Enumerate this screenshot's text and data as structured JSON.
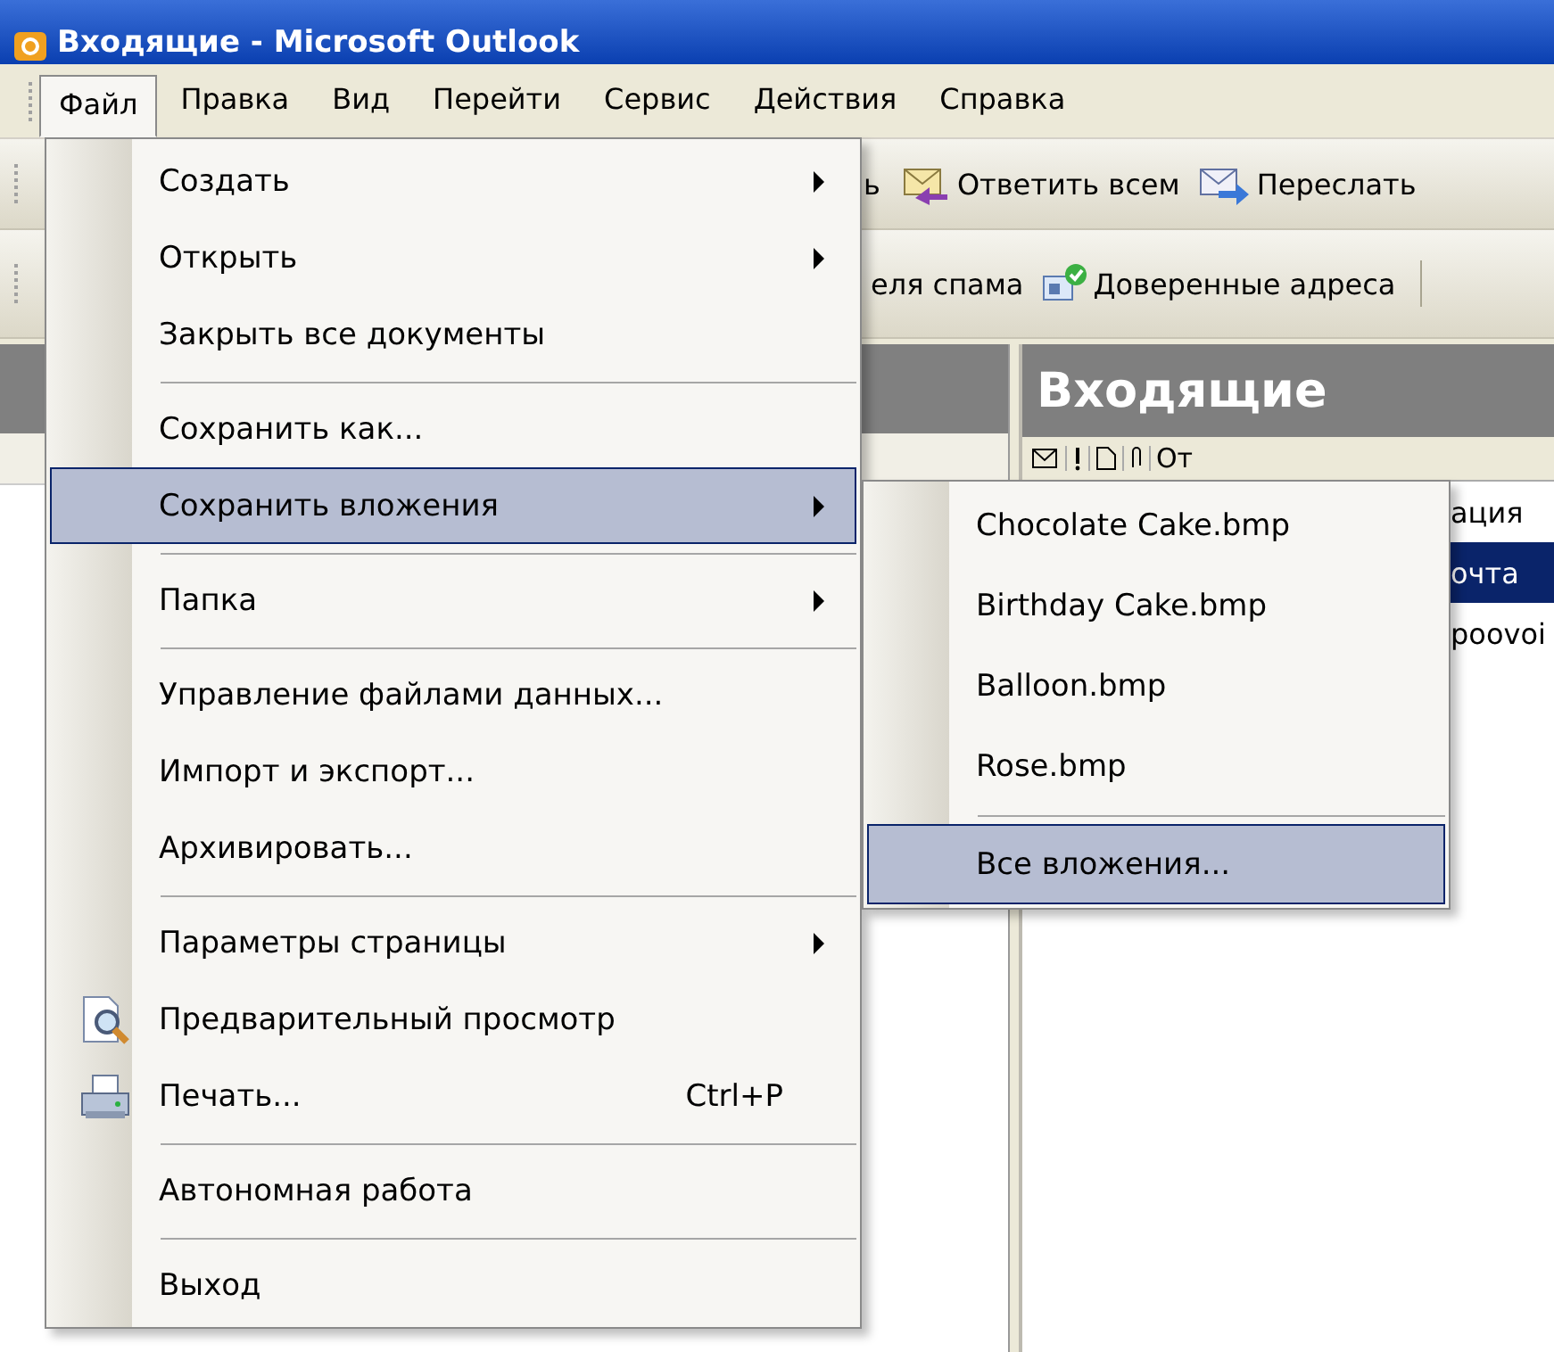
{
  "window": {
    "title": "Входящие - Microsoft Outlook"
  },
  "menu_bar": [
    {
      "label": "Файл",
      "selected": true
    },
    {
      "label": "Правка",
      "selected": false
    },
    {
      "label": "Вид",
      "selected": false
    },
    {
      "label": "Перейти",
      "selected": false
    },
    {
      "label": "Сервис",
      "selected": false
    },
    {
      "label": "Действия",
      "selected": false
    },
    {
      "label": "Справка",
      "selected": false
    }
  ],
  "toolbar_1": [
    {
      "label": "ь",
      "kind": "text"
    },
    {
      "label": "Ответить всем",
      "kind": "reply_all"
    },
    {
      "label": "Переслать",
      "kind": "forward"
    }
  ],
  "toolbar_2": [
    {
      "label": "еля спама",
      "kind": "text"
    },
    {
      "label": "Доверенные адреса",
      "kind": "trusted"
    }
  ],
  "inbox": {
    "title": "Входящие",
    "column_label": "От",
    "rows": [
      {
        "text": "ация",
        "selected": false
      },
      {
        "text": "очта",
        "selected": true
      },
      {
        "text": "poovoi",
        "selected": false
      }
    ]
  },
  "file_menu": [
    {
      "kind": "submenu",
      "label": "Создать",
      "selected": false
    },
    {
      "kind": "submenu",
      "label": "Открыть",
      "selected": false
    },
    {
      "kind": "command",
      "label": "Закрыть все документы",
      "selected": false
    },
    {
      "kind": "separator"
    },
    {
      "kind": "command",
      "label": "Сохранить как...",
      "selected": false
    },
    {
      "kind": "submenu",
      "label": "Сохранить вложения",
      "selected": true
    },
    {
      "kind": "separator"
    },
    {
      "kind": "submenu",
      "label": "Папка",
      "selected": false
    },
    {
      "kind": "separator"
    },
    {
      "kind": "command",
      "label": "Управление файлами данных...",
      "selected": false
    },
    {
      "kind": "command",
      "label": "Импорт и экспорт...",
      "selected": false
    },
    {
      "kind": "command",
      "label": "Архивировать...",
      "selected": false
    },
    {
      "kind": "separator"
    },
    {
      "kind": "submenu",
      "label": "Параметры страницы",
      "selected": false
    },
    {
      "kind": "preview",
      "label": "Предварительный просмотр",
      "selected": false
    },
    {
      "kind": "print",
      "label": "Печать...",
      "shortcut": "Ctrl+P",
      "selected": false
    },
    {
      "kind": "separator"
    },
    {
      "kind": "command",
      "label": "Автономная работа",
      "selected": false
    },
    {
      "kind": "separator"
    },
    {
      "kind": "command",
      "label": "Выход",
      "selected": false
    }
  ],
  "attachments_menu": [
    {
      "kind": "command",
      "label": "Chocolate Cake.bmp",
      "selected": false
    },
    {
      "kind": "command",
      "label": "Birthday Cake.bmp",
      "selected": false
    },
    {
      "kind": "command",
      "label": "Balloon.bmp",
      "selected": false
    },
    {
      "kind": "command",
      "label": "Rose.bmp",
      "selected": false
    },
    {
      "kind": "separator"
    },
    {
      "kind": "command",
      "label": "Все вложения...",
      "selected": true
    }
  ]
}
